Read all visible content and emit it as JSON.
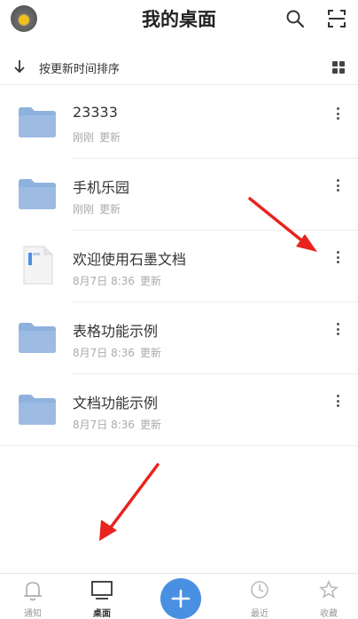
{
  "header": {
    "title": "我的桌面",
    "search_icon": "search-icon",
    "scan_icon": "scan-icon"
  },
  "sortbar": {
    "label": "按更新时间排序",
    "view_icon": "grid-view-icon"
  },
  "files": [
    {
      "name": "23333",
      "time": "刚刚",
      "action": "更新",
      "icon": "folder-icon"
    },
    {
      "name": "手机乐园",
      "time": "刚刚",
      "action": "更新",
      "icon": "folder-icon"
    },
    {
      "name": "欢迎使用石墨文档",
      "time": "8月7日 8:36",
      "action": "更新",
      "icon": "document-icon"
    },
    {
      "name": "表格功能示例",
      "time": "8月7日 8:36",
      "action": "更新",
      "icon": "folder-icon"
    },
    {
      "name": "文档功能示例",
      "time": "8月7日 8:36",
      "action": "更新",
      "icon": "folder-icon"
    }
  ],
  "tabbar": {
    "notify": "通知",
    "desktop": "桌面",
    "recent": "最近",
    "favorites": "收藏"
  },
  "colors": {
    "accent": "#4a90e2",
    "folder": "#8fb1dd",
    "annotation_arrow": "#e8231f"
  }
}
